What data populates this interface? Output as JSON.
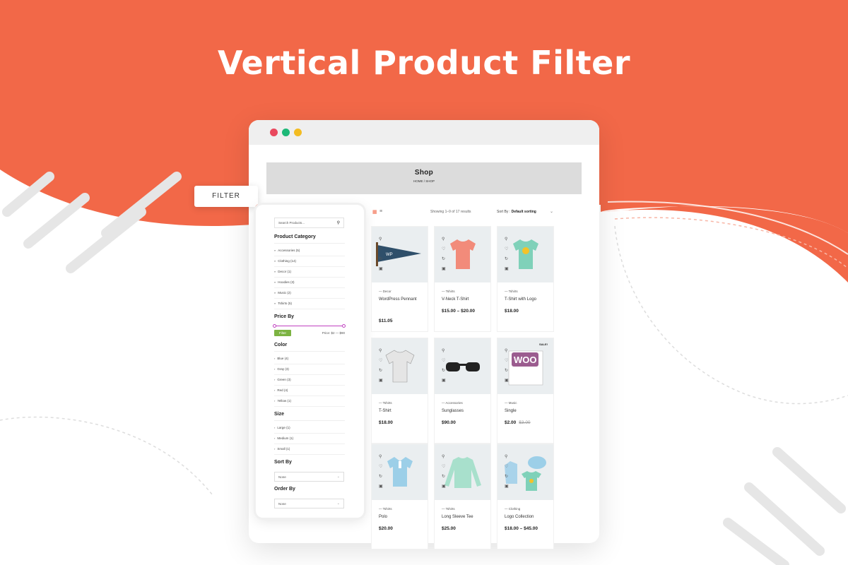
{
  "hero": {
    "title": "Vertical Product Filter"
  },
  "colors": {
    "brand": "#f26848",
    "window_red": "#e9485d",
    "window_green": "#1db877",
    "window_yellow": "#f3bc22",
    "filter_green": "#7cb342",
    "slider_purple": "#c040c0"
  },
  "filter_tag": {
    "label": "FILTER"
  },
  "shop": {
    "title": "Shop",
    "breadcrumb": "HOME / SHOP"
  },
  "sidebar": {
    "search_placeholder": "Search Products...",
    "category_heading": "Product Category",
    "categories": [
      "Accessories (5)",
      "Clothing (14)",
      "Decor (1)",
      "Hoodies (3)",
      "Music (2)",
      "Tshirts (5)"
    ],
    "price_heading": "Price By",
    "filter_button": "Filter",
    "price_range": "Price: $2 — $90",
    "color_heading": "Color",
    "colors": [
      "Blue (4)",
      "Gray (3)",
      "Green (3)",
      "Red (4)",
      "Yellow (1)"
    ],
    "size_heading": "Size",
    "sizes": [
      "Large (1)",
      "Medium (1)",
      "Small (1)"
    ],
    "sortby_heading": "Sort By",
    "sortby_value": "None",
    "orderby_heading": "Order By",
    "orderby_value": "None"
  },
  "toolbar": {
    "showing": "Showing 1–9 of 17 results",
    "sort_label": "Sort By :",
    "sort_value": "Default sorting"
  },
  "products": [
    {
      "category": "Decor",
      "name": "WordPress Pennant",
      "price": "$11.05",
      "old_price": "",
      "sale": "",
      "icon": "pennant"
    },
    {
      "category": "Tshirts",
      "name": "V-Neck T-Shirt",
      "price": "$15.00 – $20.00",
      "old_price": "",
      "sale": "",
      "icon": "tshirt-red"
    },
    {
      "category": "Tshirts",
      "name": "T-Shirt with Logo",
      "price": "$18.00",
      "old_price": "",
      "sale": "",
      "icon": "tshirt-green"
    },
    {
      "category": "Tshirts",
      "name": "T-Shirt",
      "price": "$18.00",
      "old_price": "",
      "sale": "",
      "icon": "tshirt-gray"
    },
    {
      "category": "Accessories",
      "name": "Sunglasses",
      "price": "$90.00",
      "old_price": "",
      "sale": "",
      "icon": "sunglasses"
    },
    {
      "category": "Music",
      "name": "Single",
      "price": "$2.00",
      "old_price": "$3.00",
      "sale": "SALE!",
      "icon": "album"
    },
    {
      "category": "Tshirts",
      "name": "Polo",
      "price": "$20.00",
      "old_price": "",
      "sale": "",
      "icon": "polo-blue"
    },
    {
      "category": "Tshirts",
      "name": "Long Sleeve Tee",
      "price": "$25.00",
      "old_price": "",
      "sale": "",
      "icon": "longsleeve-green"
    },
    {
      "category": "Clothing",
      "name": "Logo Collection",
      "price": "$18.00 – $45.00",
      "old_price": "",
      "sale": "",
      "icon": "collection"
    }
  ]
}
